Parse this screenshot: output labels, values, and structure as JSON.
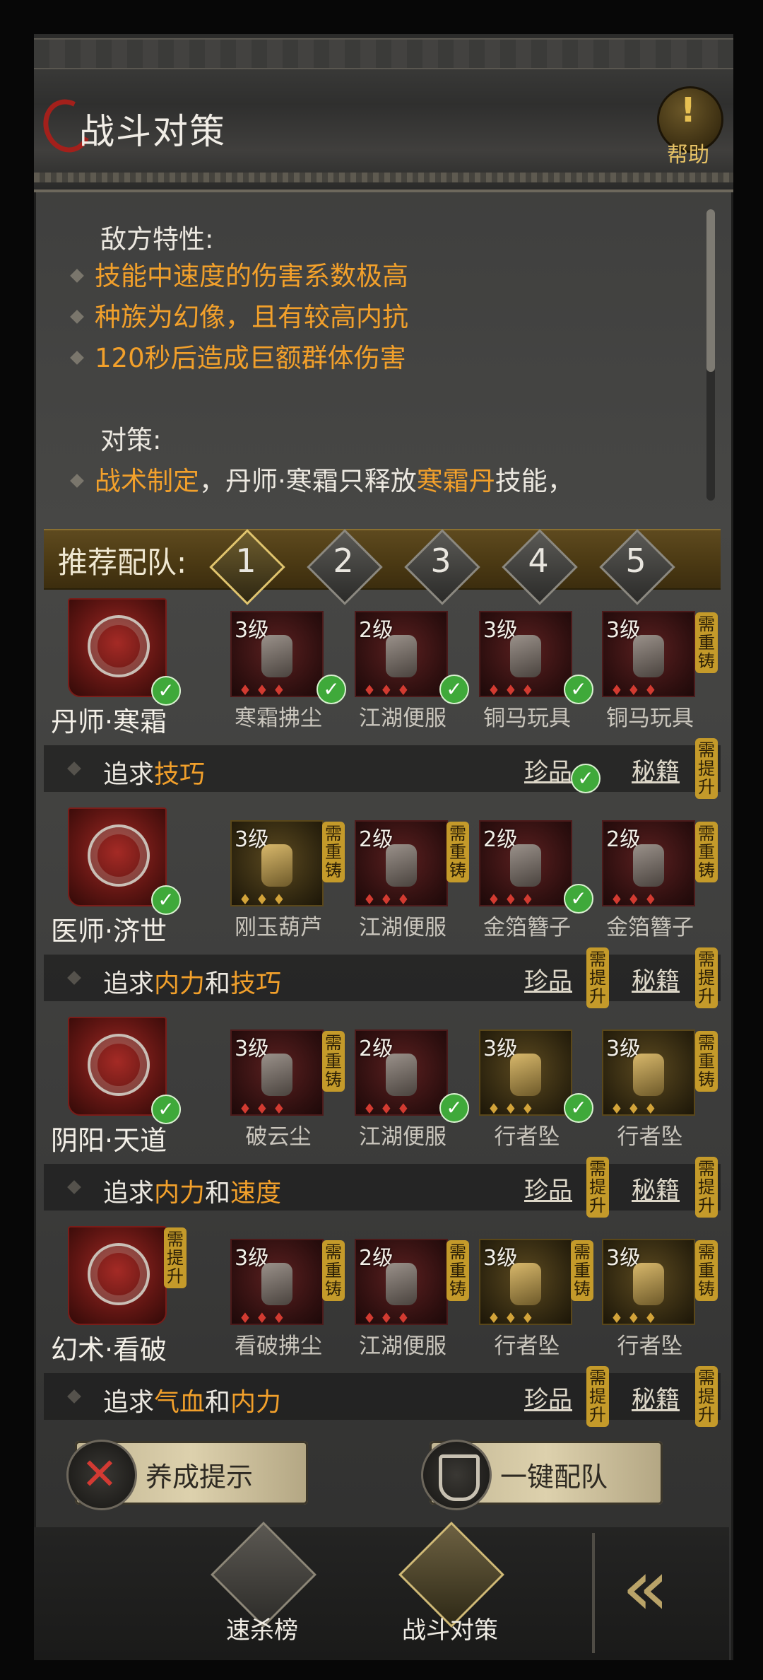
{
  "header": {
    "title": "战斗对策",
    "help_label": "帮助"
  },
  "info": {
    "enemy_title": "敌方特性:",
    "enemy_traits": [
      "技能中速度的伤害系数极高",
      "种族为幻像，且有较高内抗",
      "120秒后造成巨额群体伤害"
    ],
    "strategy_title": "对策:",
    "strategy_line": {
      "part1": "战术制定",
      "part2": "，丹师·寒霜只释放",
      "part3": "寒霜丹",
      "part4": "技能，"
    }
  },
  "recommend": {
    "label": "推荐配队:",
    "numbers": [
      "1",
      "2",
      "3",
      "4",
      "5"
    ],
    "selected": "1"
  },
  "rows": [
    {
      "character": "丹师·寒霜",
      "items": [
        {
          "level": "3级",
          "name": "寒霜拂尘"
        },
        {
          "level": "2级",
          "name": "江湖便服"
        },
        {
          "level": "3级",
          "name": "铜马玩具"
        },
        {
          "level": "3级",
          "name": "铜马玩具"
        }
      ],
      "pursue": {
        "prefix": "追求",
        "attr1": "技巧",
        "joiner": "",
        "attr2": ""
      },
      "treasure": "珍品",
      "manual": "秘籍"
    },
    {
      "character": "医师·济世",
      "items": [
        {
          "level": "3级",
          "name": "刚玉葫芦"
        },
        {
          "level": "2级",
          "name": "江湖便服"
        },
        {
          "level": "2级",
          "name": "金箔簪子"
        },
        {
          "level": "2级",
          "name": "金箔簪子"
        }
      ],
      "pursue": {
        "prefix": "追求",
        "attr1": "内力",
        "joiner": "和",
        "attr2": "技巧"
      },
      "treasure": "珍品",
      "manual": "秘籍"
    },
    {
      "character": "阴阳·天道",
      "items": [
        {
          "level": "3级",
          "name": "破云尘"
        },
        {
          "level": "2级",
          "name": "江湖便服"
        },
        {
          "level": "3级",
          "name": "行者坠"
        },
        {
          "level": "3级",
          "name": "行者坠"
        }
      ],
      "pursue": {
        "prefix": "追求",
        "attr1": "内力",
        "joiner": "和",
        "attr2": "速度"
      },
      "treasure": "珍品",
      "manual": "秘籍"
    },
    {
      "character": "幻术·看破",
      "items": [
        {
          "level": "3级",
          "name": "看破拂尘"
        },
        {
          "level": "2级",
          "name": "江湖便服"
        },
        {
          "level": "3级",
          "name": "行者坠"
        },
        {
          "level": "3级",
          "name": "行者坠"
        }
      ],
      "pursue": {
        "prefix": "追求",
        "attr1": "气血",
        "joiner": "和",
        "attr2": "内力"
      },
      "treasure": "珍品",
      "manual": "秘籍"
    }
  ],
  "badges": {
    "recast": "需重铸",
    "upgrade": "需提升"
  },
  "buttons": {
    "develop_hint": "养成提示",
    "one_click_team": "一键配队"
  },
  "footer": {
    "tabs": [
      "速杀榜",
      "战斗对策"
    ]
  },
  "colors": {
    "highlight": "#f2a02b",
    "accent_gold": "#c49a2a",
    "check_green": "#3fa93a",
    "crest_red": "#a42a25"
  }
}
